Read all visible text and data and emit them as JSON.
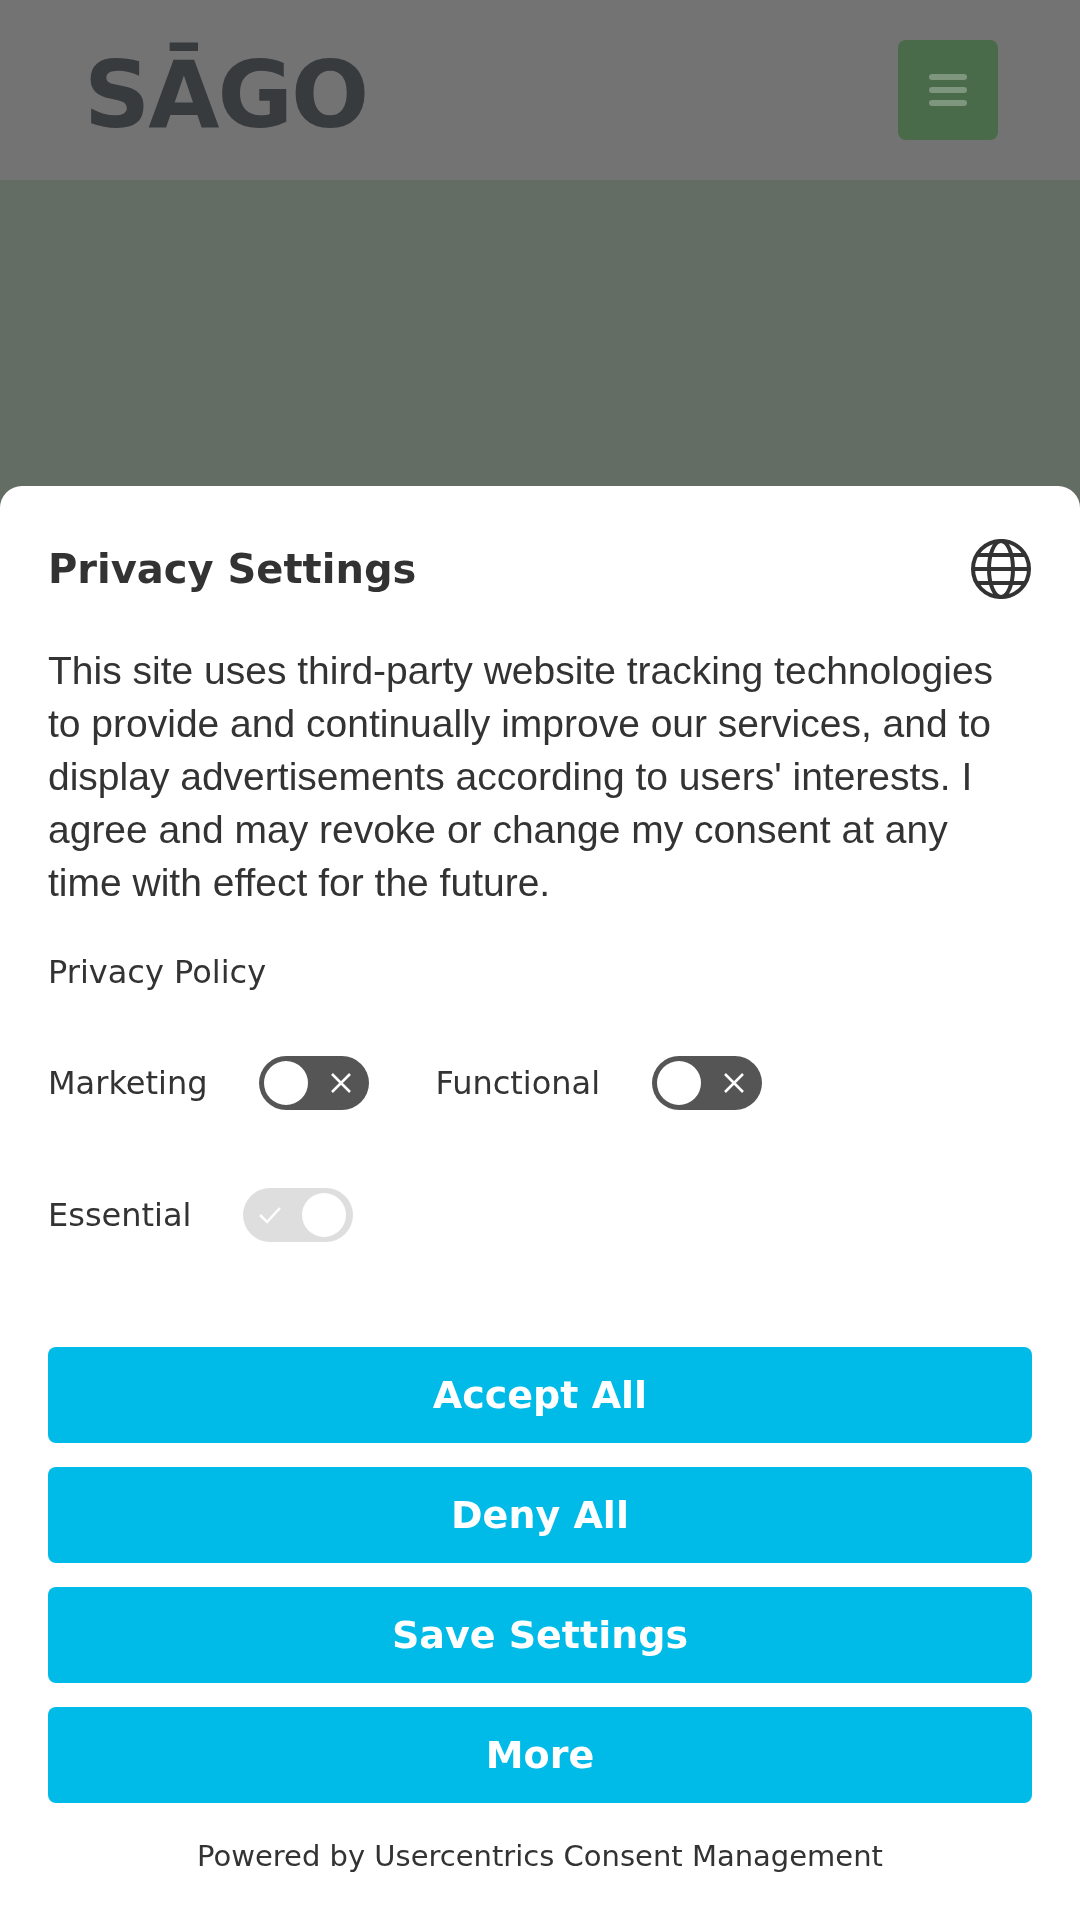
{
  "header": {
    "logo": "SĀGO"
  },
  "dialog": {
    "title": "Privacy Settings",
    "description": "This site uses third-party website tracking technologies to provide and continually improve our services, and to display advertisements according to users' interests. I agree and may revoke or change my consent at any time with effect for the future.",
    "link": "Privacy Policy",
    "toggles": [
      {
        "label": "Marketing",
        "on": false,
        "disabled": false
      },
      {
        "label": "Functional",
        "on": false,
        "disabled": false
      },
      {
        "label": "Essential",
        "on": true,
        "disabled": true
      }
    ],
    "buttons": [
      "Accept All",
      "Deny All",
      "Save Settings",
      "More"
    ],
    "footer": "Powered by Usercentrics Consent Management"
  }
}
